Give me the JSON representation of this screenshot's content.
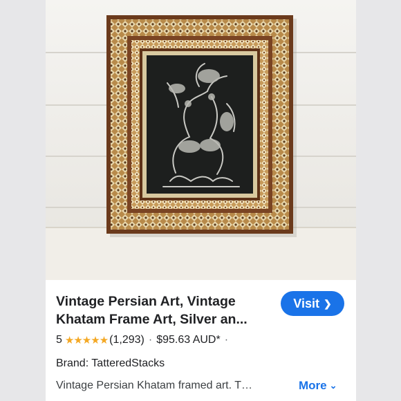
{
  "product": {
    "title": "Vintage Persian Art, Vintage Khatam Frame Art, Silver an...",
    "rating": "5",
    "stars": "★★★★★",
    "review_count": "(1,293)",
    "separator": "·",
    "price": "$95.63 AUD*",
    "brand_label": "Brand: TatteredStacks",
    "description": "Vintage Persian Khatam framed art. T…"
  },
  "actions": {
    "visit_label": "Visit",
    "visit_icon": "chevron-right-icon",
    "more_label": "More",
    "more_icon": "chevron-down-icon"
  },
  "colors": {
    "accent": "#1a73e8",
    "star": "#f4a824",
    "text": "#202124"
  }
}
